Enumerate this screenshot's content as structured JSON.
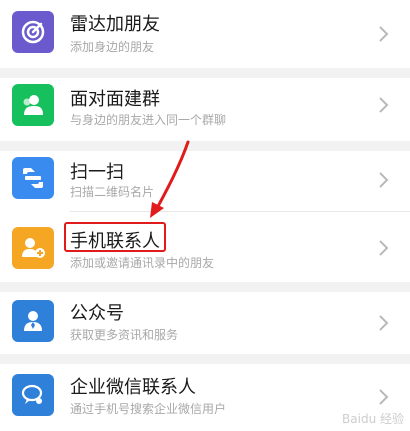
{
  "items": [
    {
      "title": "雷达加朋友",
      "subtitle": "添加身边的朋友",
      "icon": "radar-icon",
      "color": "#6A5ACD"
    },
    {
      "title": "面对面建群",
      "subtitle": "与身边的朋友进入同一个群聊",
      "icon": "face-to-face-group-icon",
      "color": "#16C05C"
    },
    {
      "title": "扫一扫",
      "subtitle": "扫描二维码名片",
      "icon": "scan-icon",
      "color": "#3A8BF0"
    },
    {
      "title": "手机联系人",
      "subtitle": "添加或邀请通讯录中的朋友",
      "icon": "phone-contacts-icon",
      "color": "#F5A623"
    },
    {
      "title": "公众号",
      "subtitle": "获取更多资讯和服务",
      "icon": "official-account-icon",
      "color": "#2F80D8"
    },
    {
      "title": "企业微信联系人",
      "subtitle": "通过手机号搜索企业微信用户",
      "icon": "wecom-contact-icon",
      "color": "#2F80D8"
    }
  ],
  "annotation": {
    "highlight_color": "#E11B1B"
  },
  "watermark": {
    "text": "Baidu 经验"
  }
}
